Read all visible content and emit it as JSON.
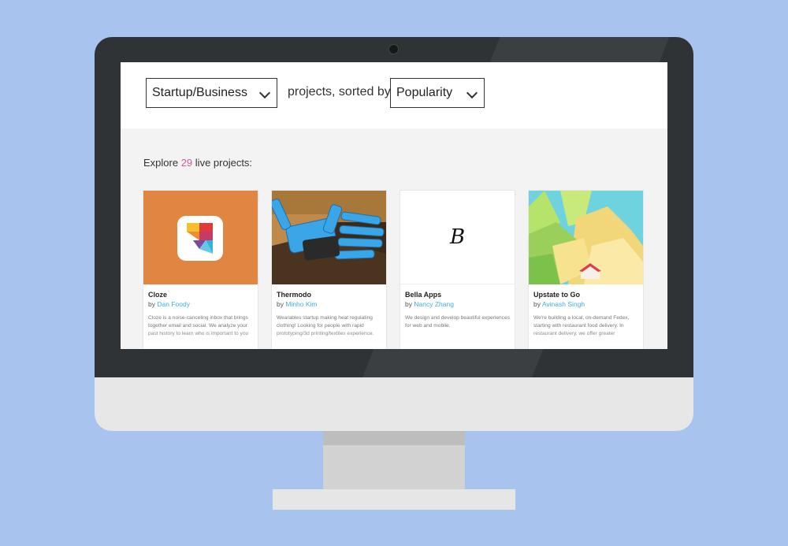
{
  "filters": {
    "category": "Startup/Business",
    "connector": "projects, sorted by",
    "sort": "Popularity"
  },
  "summary": {
    "prefix": "Explore",
    "count": "29",
    "suffix": "live projects:"
  },
  "colors": {
    "count_accent": "#d45aa6",
    "author_link": "#3ab2e6",
    "cloze_bg": "#e08542"
  },
  "cards": [
    {
      "title": "Cloze",
      "by": "by",
      "author": "Dan Foody",
      "desc": "Cloze is a noise-canceling inbox that brings together email and social. We analyze your past history to learn who is important to you"
    },
    {
      "title": "Thermodo",
      "by": "by",
      "author": "Minho Kim",
      "desc": "Wearables startup making heat regulating clothing! Looking for people with rapid prototyping/3d printing/textiles experience."
    },
    {
      "title": "Bella Apps",
      "by": "by",
      "author": "Nancy Zhang",
      "desc": "We design and develop beautiful experiences for web and mobile.",
      "logo_letter": "B"
    },
    {
      "title": "Upstate to Go",
      "by": "by",
      "author": "Avinash Singh",
      "desc": "We're building a local, on-demand Fedex, starting with restaurant food delivery. In restaurant delivery, we offer greater"
    }
  ]
}
